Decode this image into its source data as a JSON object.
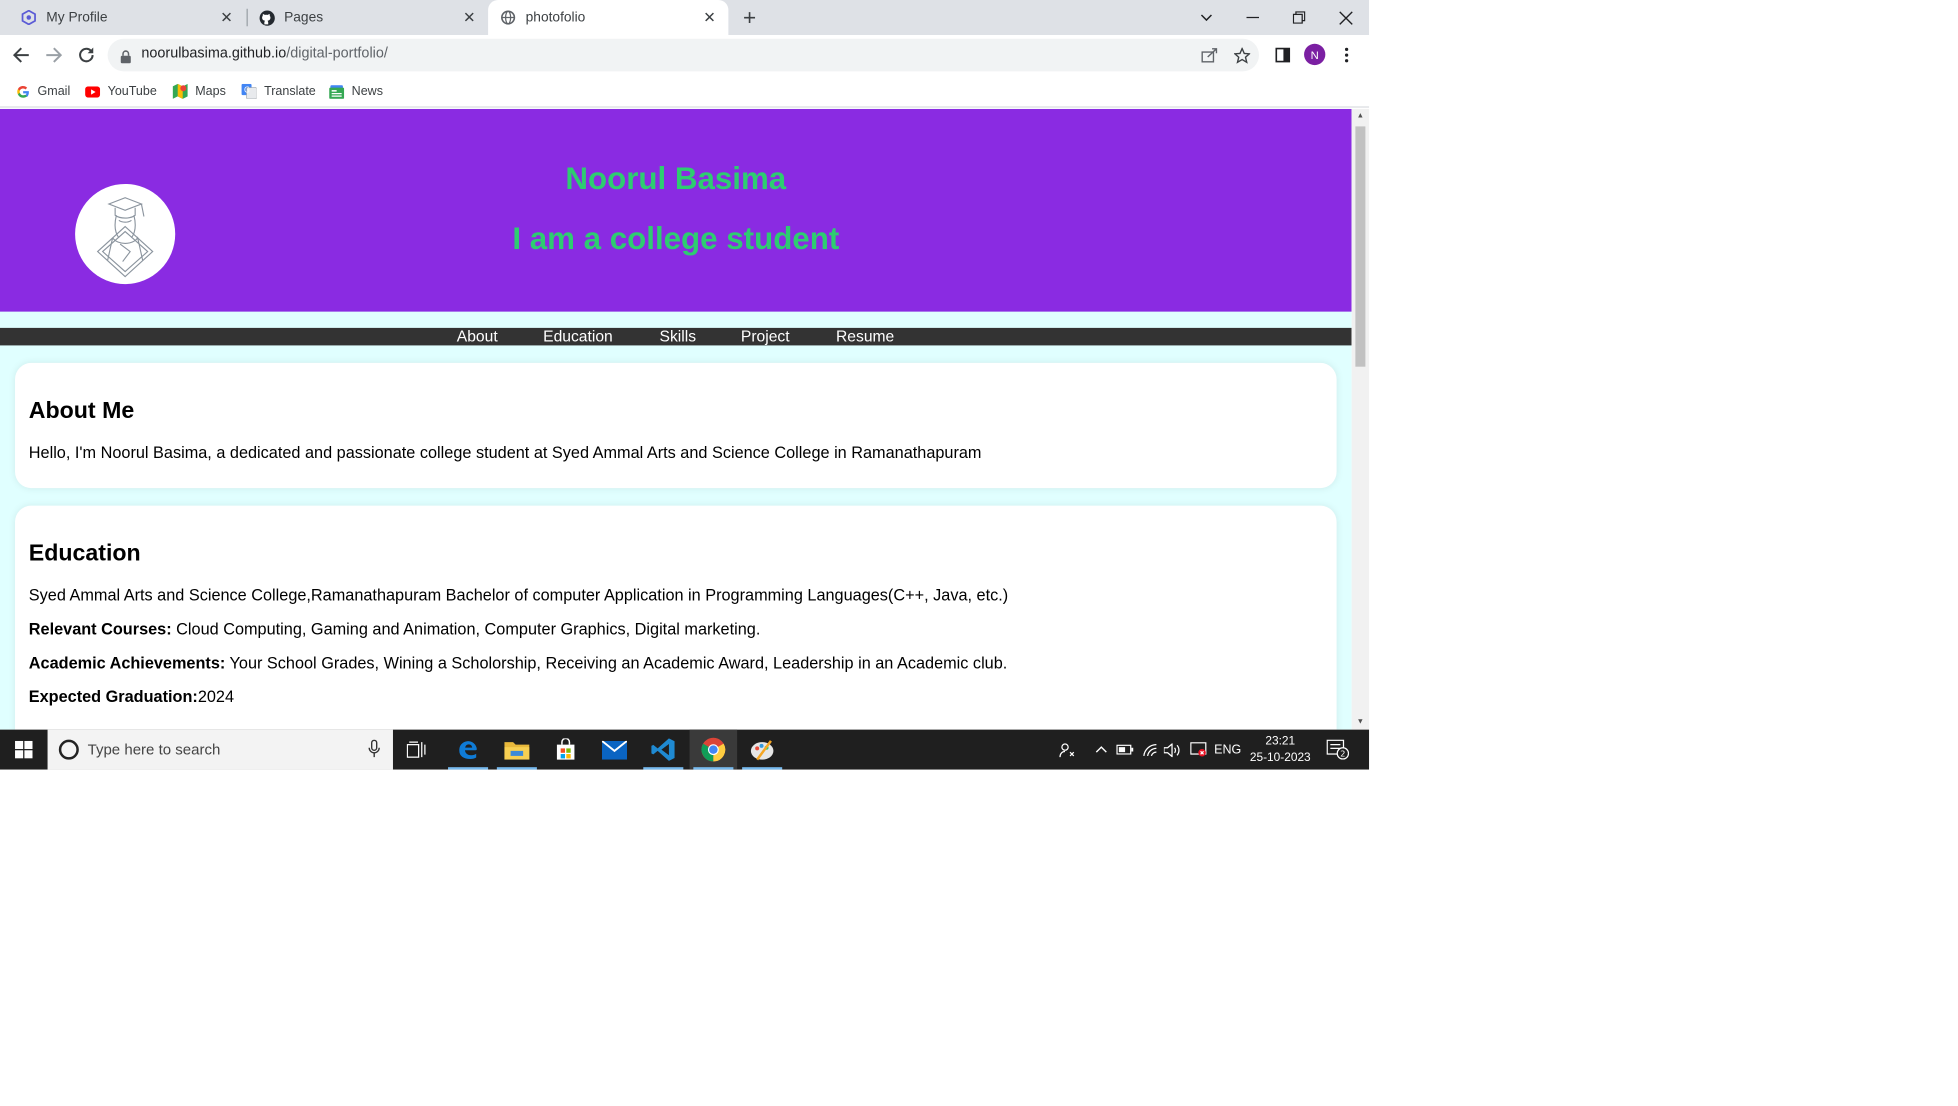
{
  "browser": {
    "tabs": [
      {
        "label": "My Profile",
        "icon": "hexagon-icon",
        "active": false
      },
      {
        "label": "Pages",
        "icon": "github-icon",
        "active": false
      },
      {
        "label": "photofolio",
        "icon": "globe-icon",
        "active": true
      }
    ],
    "url_host": "noorulbasima.github.io",
    "url_path": "/digital-portfolio/",
    "profile_initial": "N",
    "bookmarks": [
      {
        "label": "Gmail",
        "icon": "google-icon"
      },
      {
        "label": "YouTube",
        "icon": "youtube-icon"
      },
      {
        "label": "Maps",
        "icon": "maps-icon"
      },
      {
        "label": "Translate",
        "icon": "translate-icon"
      },
      {
        "label": "News",
        "icon": "news-icon"
      }
    ]
  },
  "page": {
    "header_name": "Noorul Basima",
    "header_tagline": "I am a college student",
    "nav": [
      "About",
      "Education",
      "Skills",
      "Project",
      "Resume"
    ],
    "about": {
      "heading": "About Me",
      "text": "Hello, I'm Noorul Basima, a dedicated and passionate college student at Syed Ammal Arts and Science College in Ramanathapuram"
    },
    "education": {
      "heading": "Education",
      "line1": "Syed Ammal Arts and Science College,Ramanathapuram Bachelor of computer Application in Programming Languages(C++, Java, etc.)",
      "courses_label": "Relevant Courses:",
      "courses_text": " Cloud Computing, Gaming and Animation, Computer Graphics, Digital marketing.",
      "achievements_label": "Academic Achievements:",
      "achievements_text": " Your School Grades, Wining a Scholorship, Receiving an Academic Award, Leadership in an Academic club.",
      "graduation_label": "Expected Graduation:",
      "graduation_text": "2024"
    },
    "colors": {
      "header_bg": "#8a2be2",
      "header_text": "#2ecc71",
      "nav_bg": "#333333",
      "page_bg": "#e0ffff"
    }
  },
  "taskbar": {
    "search_placeholder": "Type here to search",
    "language": "ENG",
    "time": "23:21",
    "date": "25-10-2023",
    "notification_count": "2"
  }
}
